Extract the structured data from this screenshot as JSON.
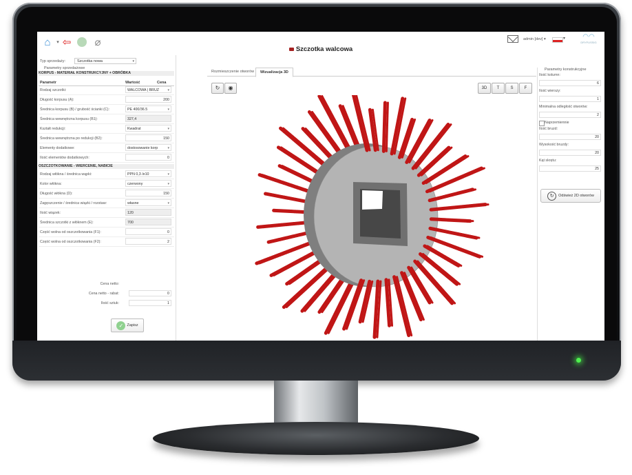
{
  "app": {
    "title": "Szczotka walcowa",
    "user_label": "admin [dev] ▾",
    "logo_text": "DRYFUSSIG"
  },
  "colors": {
    "brand_red": "#a52020",
    "bristle_red": "#c01616",
    "hub_gray": "#b4b4b4"
  },
  "sale": {
    "label": "Typ sprzedaży:",
    "value": "Szczotka nowa"
  },
  "left": {
    "legend": "Parametry sprzedażowe",
    "section1": "KORPUS - MATERIAŁ KONSTRUKCYJNY + OBRÓBKA",
    "headers": {
      "param": "Parametr",
      "value": "Wartość",
      "price": "Cena"
    },
    "rows1": [
      {
        "label": "Rodzaj szczotki:",
        "value": "WALCOWA | BRUZ",
        "kind": "sel"
      },
      {
        "label": "Długość korpusu (A):",
        "value": "200",
        "kind": "num"
      },
      {
        "label": "Średnica korpusu (B) / grubość ścianki (C):",
        "value": "PE 400/36.5",
        "kind": "sel"
      },
      {
        "label": "Średnica wewnętrzna korpusu (B1):",
        "value": "327,4",
        "kind": "ro"
      },
      {
        "label": "Kształt redukcji:",
        "value": "Kwadrat",
        "kind": "sel"
      },
      {
        "label": "Średnica wewnętrzna po redukcji (B2):",
        "value": "150",
        "kind": "num"
      },
      {
        "label": "Elementy dodatkowe:",
        "value": "dostosowanie korp",
        "kind": "sel"
      },
      {
        "label": "Ilość elementów dodatkowych:",
        "value": "0",
        "kind": "num"
      }
    ],
    "section2": "OSZCZOTKOWANIE - WIERCENIE, NABICIE",
    "rows2": [
      {
        "label": "Rodzaj włókna / średnica wąpki:",
        "value": "PPN 0,3 /e10",
        "kind": "sel"
      },
      {
        "label": "Kolor włókna:",
        "value": "czerwony",
        "kind": "sel"
      },
      {
        "label": "Długość włókna (D):",
        "value": "150",
        "kind": "num"
      },
      {
        "label": "Zagęszczenie / średnica wiązki / rozstaw:",
        "value": "własne",
        "kind": "sel"
      },
      {
        "label": "Ilość wiązek:",
        "value": "120",
        "kind": "ro"
      },
      {
        "label": "Średnica szczotki z włóknem (E):",
        "value": "700",
        "kind": "ro"
      },
      {
        "label": "Część wolna od oszczotkowania (F1):",
        "value": "0",
        "kind": "num"
      },
      {
        "label": "Część wolna od oszczotkowania (F2):",
        "value": "2",
        "kind": "num"
      }
    ],
    "price": [
      {
        "label": "Cena netto:",
        "value": ""
      },
      {
        "label": "Cena netto - rabat:",
        "value": "0"
      },
      {
        "label": "Ilość sztuk:",
        "value": "1"
      }
    ],
    "save_label": "Zapisz"
  },
  "center": {
    "tabs": [
      "Rozmieszczenie otworów",
      "Wizualizacja 3D"
    ],
    "active_tab": 1,
    "tools": [
      "↻",
      "◉"
    ],
    "views": [
      "3D",
      "T",
      "S",
      "F"
    ]
  },
  "right": {
    "legend": "Parametry konstrukcyjne",
    "fields": [
      {
        "label": "Ilość kolumn:",
        "value": "6"
      },
      {
        "label": "Ilość wierszy:",
        "value": "1"
      },
      {
        "label": "Minimalna odległość otworów:",
        "value": "2"
      }
    ],
    "checkbox_label": "Naprzemiennie",
    "fields2": [
      {
        "label": "Ilość bruzd:",
        "value": "20"
      },
      {
        "label": "Wysokość bruzdy:",
        "value": "20"
      },
      {
        "label": "Kąt skrętu:",
        "value": "25"
      }
    ],
    "refresh_label": "Odśwież 2D otworów"
  }
}
